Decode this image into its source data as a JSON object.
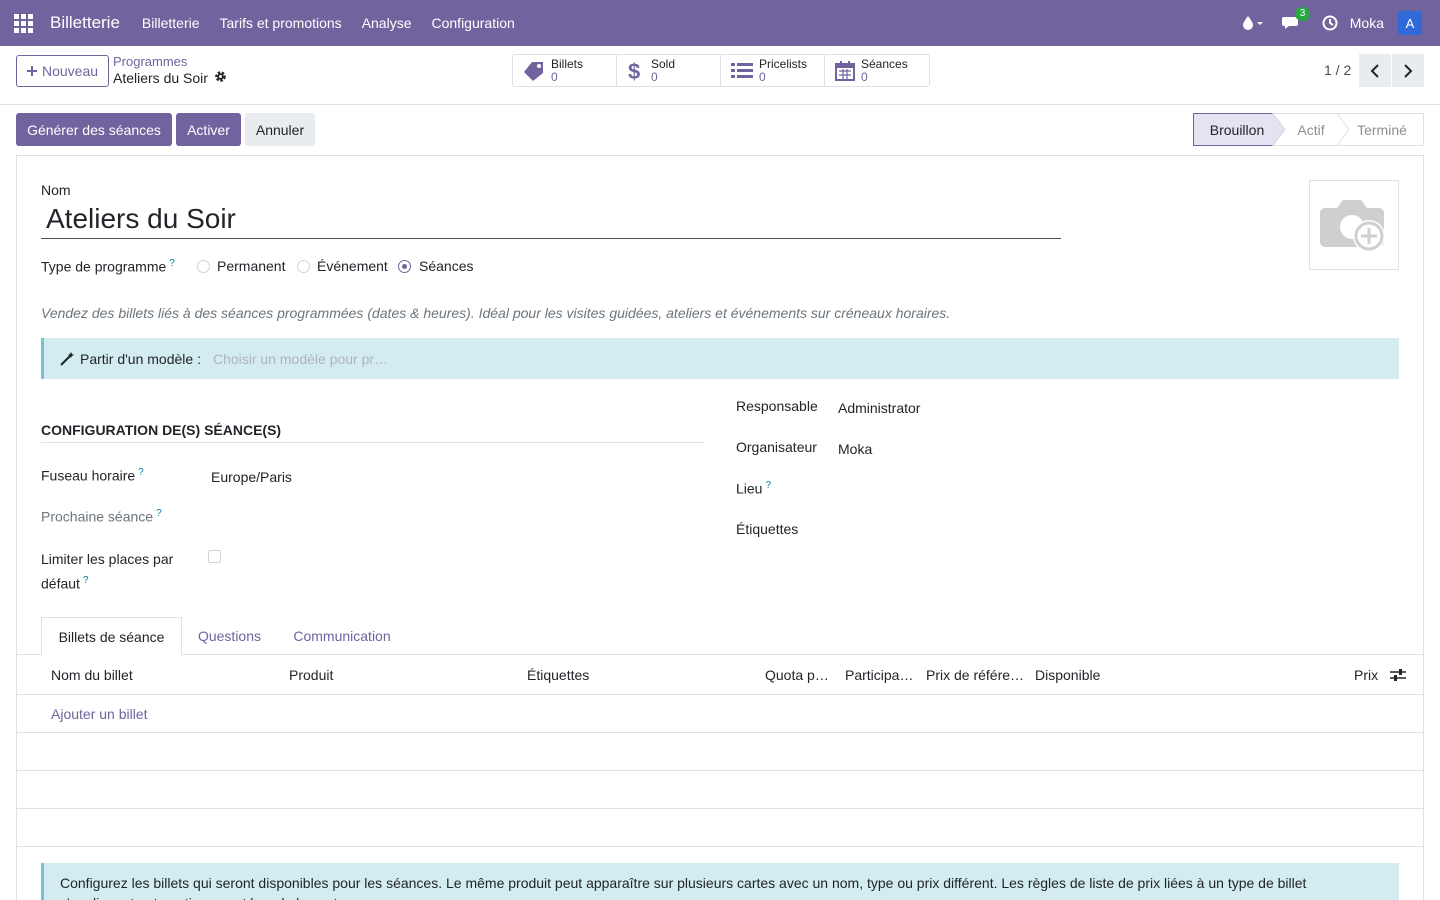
{
  "navbar": {
    "brand": "Billetterie",
    "menu": [
      "Billetterie",
      "Tarifs et promotions",
      "Analyse",
      "Configuration"
    ],
    "chat_count": "3",
    "user": "Moka",
    "avatar_letter": "A"
  },
  "control": {
    "new_button": "Nouveau",
    "breadcrumb_parent": "Programmes",
    "breadcrumb_current": "Ateliers du Soir",
    "smart_buttons": [
      {
        "label": "Billets",
        "value": "0",
        "icon": "ticket-icon"
      },
      {
        "label": "Sold",
        "value": "0",
        "icon": "dollar-icon"
      },
      {
        "label": "Pricelists",
        "value": "0",
        "icon": "list-icon"
      },
      {
        "label": "Séances",
        "value": "0",
        "icon": "calendar-icon"
      }
    ],
    "pager": "1 / 2"
  },
  "actions": {
    "generate": "Générer des séances",
    "activate": "Activer",
    "cancel": "Annuler"
  },
  "stages": [
    "Brouillon",
    "Actif",
    "Terminé"
  ],
  "form": {
    "name_label": "Nom",
    "name_value": "Ateliers du Soir",
    "type_label": "Type de programme",
    "type_options": [
      "Permanent",
      "Événement",
      "Séances"
    ],
    "type_selected": "Séances",
    "description": "Vendez des billets liés à des séances programmées (dates & heures). Idéal pour les visites guidées, ateliers et événements sur créneaux horaires.",
    "template_label": "Partir d'un modèle :",
    "template_placeholder": "Choisir un modèle pour pr…",
    "section_title": "CONFIGURATION DE(S) SÉANCE(S)",
    "timezone_label": "Fuseau horaire",
    "timezone_value": "Europe/Paris",
    "next_session_label": "Prochaine séance",
    "limit_label_1": "Limiter les places par",
    "limit_label_2": "défaut",
    "responsible_label": "Responsable",
    "responsible_value": "Administrator",
    "organizer_label": "Organisateur",
    "organizer_value": "Moka",
    "location_label": "Lieu",
    "tags_label": "Étiquettes"
  },
  "tabs": [
    "Billets de séance",
    "Questions",
    "Communication"
  ],
  "table": {
    "columns": [
      "Nom du billet",
      "Produit",
      "Étiquettes",
      "Quota p…",
      "Participa…",
      "Prix de référe…",
      "Disponible",
      "Prix"
    ],
    "add_line": "Ajouter un billet"
  },
  "info": "Configurez les billets qui seront disponibles pour les séances. Le même produit peut apparaître sur plusieurs cartes avec un nom, type ou prix différent. Les règles de liste de prix liées à un type de billet s'appliquent automatiquement lors de la vente."
}
